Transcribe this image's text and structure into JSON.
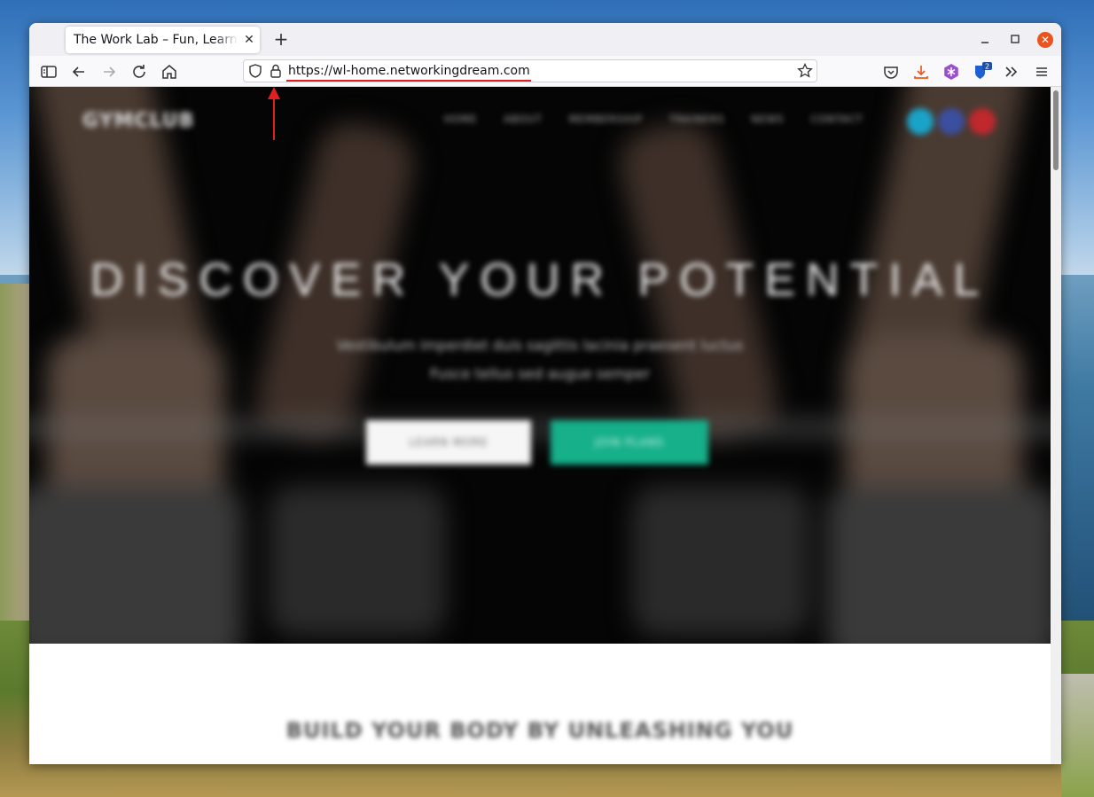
{
  "browser": {
    "tab_title": "The Work Lab – Fun, Learn, Work",
    "url": "https://wl-home.networkingdream.com",
    "accent_color": "#e95420",
    "annotation_color": "#e02020"
  },
  "site": {
    "logo": "GYMCLUB",
    "nav_items": [
      "HOME",
      "ABOUT",
      "MEMBERSHIP",
      "TRAINERS",
      "NEWS",
      "CONTACT"
    ],
    "hero_title": "DISCOVER YOUR POTENTIAL",
    "hero_subtitle_1": "Vestibulum imperdiet duis sagittis lacinia praesent luctus",
    "hero_subtitle_2": "Fusce tellus sed augue semper",
    "btn_learn": "LEARN MORE",
    "btn_join": "JOIN PLANS",
    "section_title": "BUILD YOUR BODY BY UNLEASHING YOU",
    "accent_color": "#16b08a"
  }
}
